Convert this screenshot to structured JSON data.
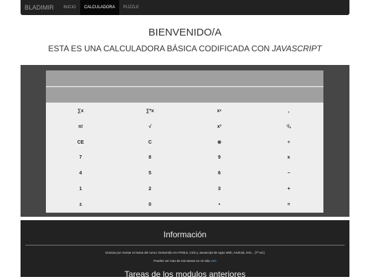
{
  "navbar": {
    "brand": "BLADIMIR",
    "links": [
      "INICIO",
      "CALCULADORA",
      "PUZZLE"
    ],
    "active_index": 1
  },
  "header": {
    "welcome": "BIENVENIDO/A",
    "subtitle_plain": "ESTA ES UNA CALCULADORA BÁSICA CODIFICADA CON ",
    "subtitle_em": "JAVASCRIPT"
  },
  "calculator": {
    "display_primary": "",
    "display_secondary": "",
    "keys": [
      "∑x",
      "∑*x",
      "xⁿ",
      ",",
      "n!",
      "√",
      "x²",
      "¹/ₓ",
      "CE",
      "C",
      "⊗",
      "÷",
      "7",
      "8",
      "9",
      "x",
      "4",
      "5",
      "6",
      "−",
      "1",
      "2",
      "3",
      "+",
      "±",
      "0",
      "•",
      "="
    ]
  },
  "footer": {
    "info_title": "Información",
    "line1": "Gracias por revisar mi tarea del curso: Desarrollo en HTML5, CSS y Javascript de Apps Web, Android, IOS... (7ª ed.)",
    "line2_text": "Puedes ver mas de mis tareas en mi sitio ",
    "line2_link": "web",
    "prev_title": "Tareas de los modulos anteriores"
  }
}
